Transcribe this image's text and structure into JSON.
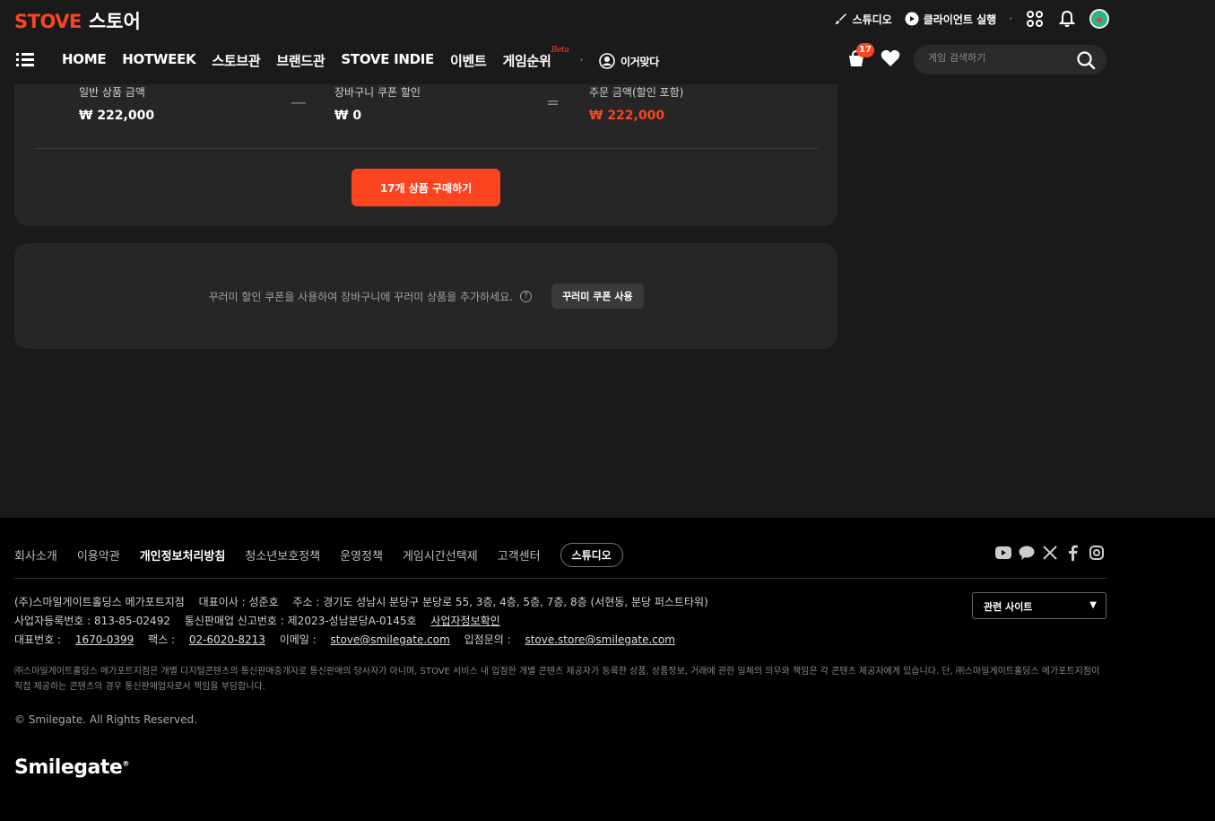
{
  "header": {
    "logo_brand": "STOVE",
    "logo_store": "스토어",
    "studio": "스튜디오",
    "client_run": "클라이언트 실행"
  },
  "nav": {
    "items": [
      "HOME",
      "HOTWEEK",
      "스토브관",
      "브랜드관",
      "STOVE INDIE",
      "이벤트",
      "게임순위"
    ],
    "beta": "Beta",
    "profile_name": "이거맞다",
    "cart_count": "17",
    "search_placeholder": "게임 검색하기"
  },
  "summary": {
    "regular_label": "일반 상품 금액",
    "regular_value": "₩ 222,000",
    "minus": "—",
    "coupon_label": "장바구니 쿠폰 할인",
    "coupon_value": "₩ 0",
    "equals": "=",
    "order_label": "주문 금액(할인 포함)",
    "order_value": "₩ 222,000",
    "buy_button": "17개 상품 구매하기"
  },
  "coupon": {
    "text": "꾸러미 할인 쿠폰을 사용하여 장바구니에 꾸러미 상품을 추가하세요.",
    "help": "?",
    "button": "꾸러미 쿠폰 사용"
  },
  "footer": {
    "links": [
      "회사소개",
      "이용약관",
      "개인정보처리방침",
      "청소년보호정책",
      "운영정책",
      "게임시간선택제",
      "고객센터"
    ],
    "studio": "스튜디오",
    "company_line1": [
      "(주)스마일게이트홀딩스 메가포트지점",
      "대표이사 : 성준호",
      "주소 : 경기도 성남시 분당구 분당로 55, 3층, 4층, 5층, 7층, 8층 (서현동, 분당 퍼스트타워)"
    ],
    "biz_no": "사업자등록번호 : 813-85-02492",
    "mail_order": "통신판매업 신고번호 : 제2023-성남분당A-0145호",
    "biz_info": "사업자정보확인",
    "rep_label": "대표번호 : ",
    "rep_phone": "1670-0399",
    "fax_label": "팩스 : ",
    "fax": "02-6020-8213",
    "email_label": "이메일 : ",
    "email": "stove@smilegate.com",
    "store_label": "입점문의 : ",
    "store_email": "stove.store@smilegate.com",
    "related": "관련 사이트",
    "notice": "㈜스마일게이트홀딩스 메가포트지점은 개별 디지털콘텐츠의 통신판매중개자로 통신판매의 당사자가 아니며, STOVE 서비스 내 입점한 개별 콘텐츠 제공자가 등록한 상품, 상품정보, 거래에 관한 일체의 의무와 책임은 각 콘텐츠 제공자에게 있습니다. 단, ㈜스마일게이트홀딩스 메가포트지점이 직접 제공하는 콘텐츠의 경우 통신판매업자로서 책임을 부담합니다.",
    "copyright": "© Smilegate. All Rights Reserved.",
    "logo": "Smilegate"
  },
  "colors": {
    "accent": "#fc4420",
    "bg": "#1a1a1a",
    "panel": "#262626",
    "footer": "#000000"
  }
}
